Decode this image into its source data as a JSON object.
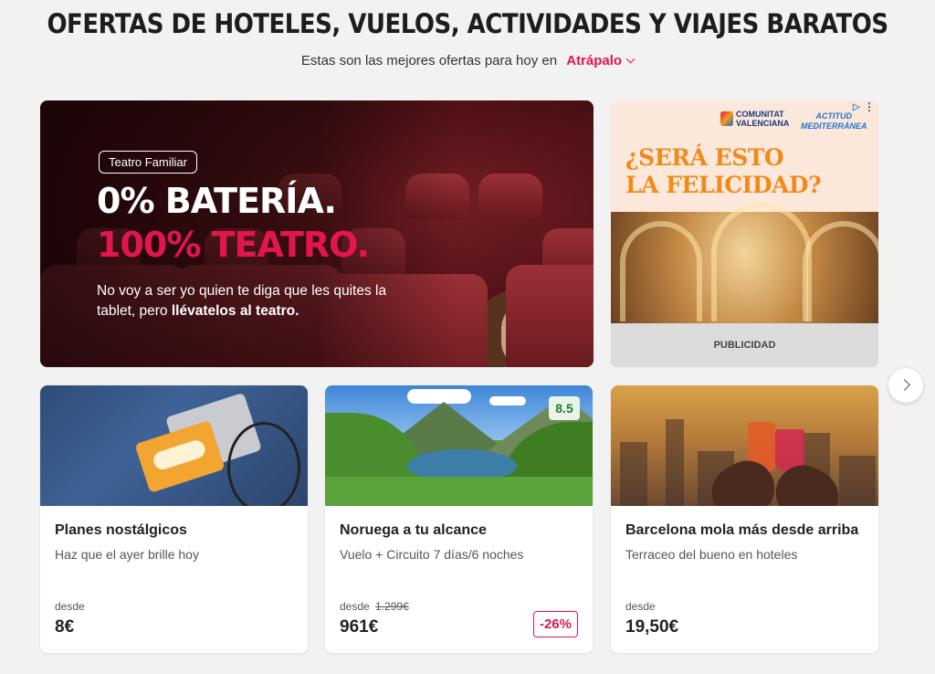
{
  "header": {
    "title": "OFERTAS DE HOTELES, VUELOS, ACTIVIDADES Y VIAJES BARATOS",
    "subtitle": "Estas son las mejores ofertas para hoy en",
    "brand": "Atrápalo"
  },
  "hero": {
    "tag": "Teatro Familiar",
    "line1": "0% BATERÍA.",
    "line2": "100% TEATRO.",
    "text_plain": "No voy a ser yo quien te diga que les quites la tablet, pero ",
    "text_bold": "llévatelos al teatro."
  },
  "ad": {
    "logo1_line1": "COMUNITAT",
    "logo1_line2": "VALENCIANA",
    "logo2_line1": "ACTITUD",
    "logo2_line2": "MEDITERRÁNEA",
    "headline_line1": "¿SERÁ ESTO",
    "headline_line2": "LA FELICIDAD?",
    "footer": "PUBLICIDAD",
    "info_glyph": "▷",
    "menu_glyph": "⋮"
  },
  "cards": [
    {
      "title": "Planes nostálgicos",
      "subtitle": "Haz que el ayer brille hoy",
      "desde": "desde",
      "old_price": "",
      "price": "8€"
    },
    {
      "title": "Noruega a tu alcance",
      "subtitle": "Vuelo + Circuito 7 días/6 noches",
      "desde": "desde",
      "old_price": "1.299€",
      "price": "961€",
      "discount": "-26%",
      "rating": "8.5"
    },
    {
      "title": "Barcelona mola más desde arriba",
      "subtitle": "Terraceo del bueno en hoteles",
      "desde": "desde",
      "old_price": "",
      "price": "19,50€"
    }
  ],
  "colors": {
    "brand": "#e2164e",
    "background": "#f2f2f2"
  }
}
